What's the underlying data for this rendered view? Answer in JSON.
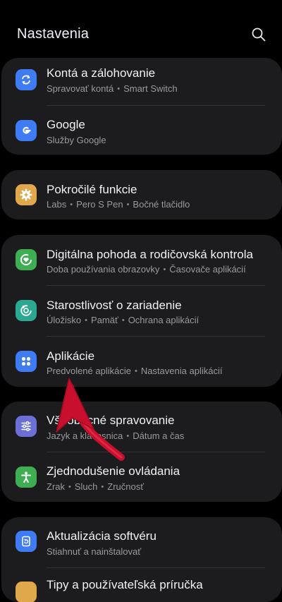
{
  "header": {
    "title": "Nastavenia"
  },
  "groups": [
    {
      "items": [
        {
          "label": "Kontá a zálohovanie",
          "sub": [
            "Spravovať kontá",
            "Smart Switch"
          ],
          "icon": "sync-icon",
          "color": "#3f7cf4"
        },
        {
          "label": "Google",
          "sub": [
            "Služby Google"
          ],
          "icon": "google-icon",
          "color": "#3f7cf4"
        }
      ]
    },
    {
      "items": [
        {
          "label": "Pokročilé funkcie",
          "sub": [
            "Labs",
            "Pero S Pen",
            "Bočné tlačidlo"
          ],
          "icon": "gear-plus-icon",
          "color": "#e0a84a"
        }
      ]
    },
    {
      "items": [
        {
          "label": "Digitálna pohoda a rodičovská kontrola",
          "sub": [
            "Doba používania obrazovky",
            "Časovače aplikácií"
          ],
          "icon": "heart-circle-icon",
          "color": "#3fae52"
        },
        {
          "label": "Starostlivosť o zariadenie",
          "sub": [
            "Úložisko",
            "Pamäť",
            "Ochrana aplikácií"
          ],
          "icon": "device-care-icon",
          "color": "#2aa892"
        },
        {
          "label": "Aplikácie",
          "sub": [
            "Predvolené aplikácie",
            "Nastavenia aplikácií"
          ],
          "icon": "apps-grid-icon",
          "color": "#3f7cf4"
        }
      ]
    },
    {
      "items": [
        {
          "label": "Všeobecné spravovanie",
          "sub": [
            "Jazyk a klávesnica",
            "Dátum a čas"
          ],
          "icon": "sliders-icon",
          "color": "#6b6fd6"
        },
        {
          "label": "Zjednodušenie ovládania",
          "sub": [
            "Zrak",
            "Sluch",
            "Zručnosť"
          ],
          "icon": "accessibility-icon",
          "color": "#3fae52"
        }
      ]
    },
    {
      "items": [
        {
          "label": "Aktualizácia softvéru",
          "sub": [
            "Stiahnuť a nainštalovať"
          ],
          "icon": "update-icon",
          "color": "#3f7cf4"
        },
        {
          "label": "Tipy a používateľská príručka",
          "sub": [],
          "icon": "lightbulb-icon",
          "color": "#e0a84a"
        }
      ]
    }
  ],
  "colors": {
    "background": "#000000",
    "card": "#1c1c1e",
    "arrow": "#c8102e"
  }
}
